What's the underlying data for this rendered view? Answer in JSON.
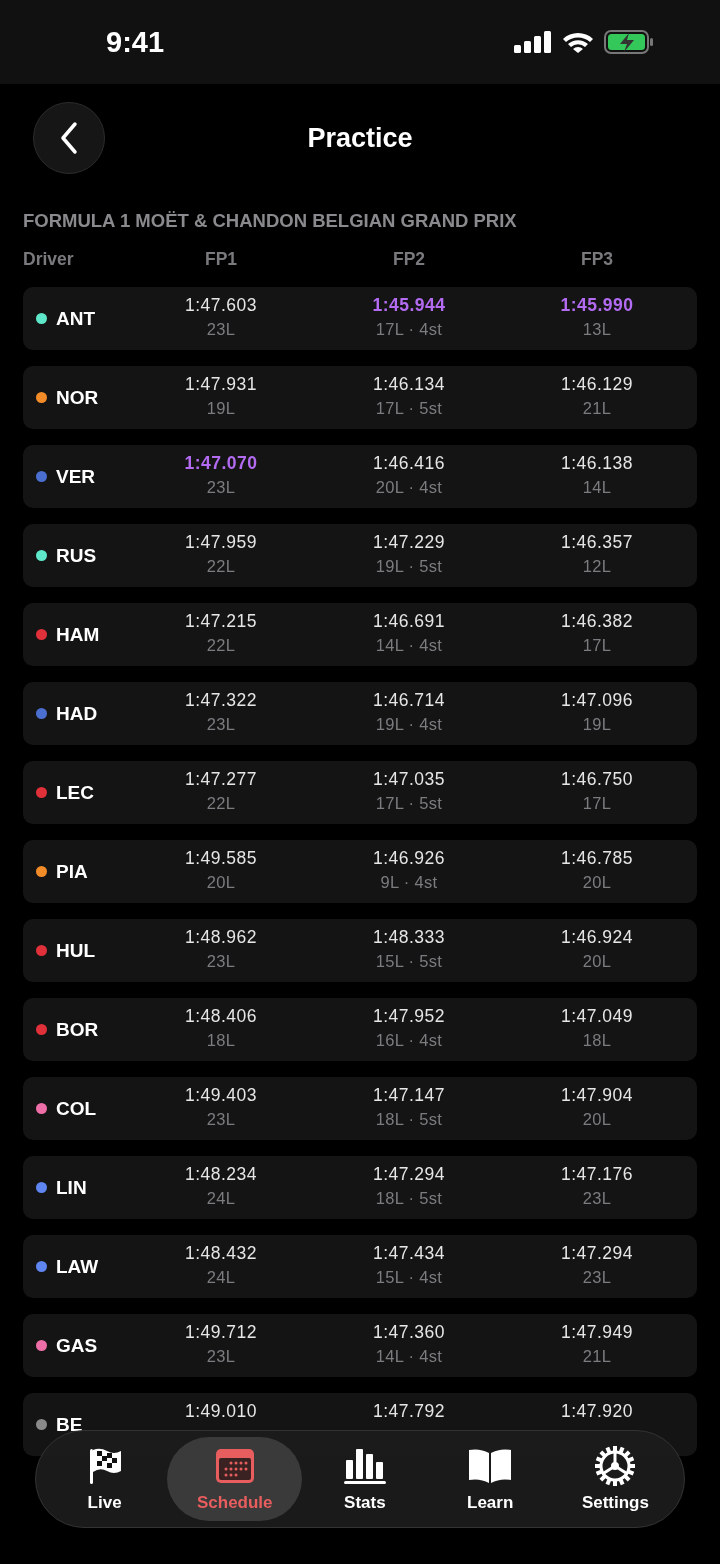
{
  "status_bar": {
    "time": "9:41"
  },
  "header": {
    "title": "Practice"
  },
  "event": {
    "title": "FORMULA 1 MOËT & CHANDON BELGIAN GRAND PRIX"
  },
  "columns": [
    "Driver",
    "FP1",
    "FP2",
    "FP3"
  ],
  "rows": [
    {
      "driver": "ANT",
      "color": "#5ee8c9",
      "sessions": [
        {
          "time": "1:47.603",
          "laps": "23L",
          "best": false
        },
        {
          "time": "1:45.944",
          "laps": "17L · 4st",
          "best": true
        },
        {
          "time": "1:45.990",
          "laps": "13L",
          "best": true
        }
      ]
    },
    {
      "driver": "NOR",
      "color": "#f28c28",
      "sessions": [
        {
          "time": "1:47.931",
          "laps": "19L",
          "best": false
        },
        {
          "time": "1:46.134",
          "laps": "17L · 5st",
          "best": false
        },
        {
          "time": "1:46.129",
          "laps": "21L",
          "best": false
        }
      ]
    },
    {
      "driver": "VER",
      "color": "#4a6fd1",
      "sessions": [
        {
          "time": "1:47.070",
          "laps": "23L",
          "best": true
        },
        {
          "time": "1:46.416",
          "laps": "20L · 4st",
          "best": false
        },
        {
          "time": "1:46.138",
          "laps": "14L",
          "best": false
        }
      ]
    },
    {
      "driver": "RUS",
      "color": "#5ee8c9",
      "sessions": [
        {
          "time": "1:47.959",
          "laps": "22L",
          "best": false
        },
        {
          "time": "1:47.229",
          "laps": "19L · 5st",
          "best": false
        },
        {
          "time": "1:46.357",
          "laps": "12L",
          "best": false
        }
      ]
    },
    {
      "driver": "HAM",
      "color": "#e0303a",
      "sessions": [
        {
          "time": "1:47.215",
          "laps": "22L",
          "best": false
        },
        {
          "time": "1:46.691",
          "laps": "14L · 4st",
          "best": false
        },
        {
          "time": "1:46.382",
          "laps": "17L",
          "best": false
        }
      ]
    },
    {
      "driver": "HAD",
      "color": "#4a6fd1",
      "sessions": [
        {
          "time": "1:47.322",
          "laps": "23L",
          "best": false
        },
        {
          "time": "1:46.714",
          "laps": "19L · 4st",
          "best": false
        },
        {
          "time": "1:47.096",
          "laps": "19L",
          "best": false
        }
      ]
    },
    {
      "driver": "LEC",
      "color": "#e0303a",
      "sessions": [
        {
          "time": "1:47.277",
          "laps": "22L",
          "best": false
        },
        {
          "time": "1:47.035",
          "laps": "17L · 5st",
          "best": false
        },
        {
          "time": "1:46.750",
          "laps": "17L",
          "best": false
        }
      ]
    },
    {
      "driver": "PIA",
      "color": "#f28c28",
      "sessions": [
        {
          "time": "1:49.585",
          "laps": "20L",
          "best": false
        },
        {
          "time": "1:46.926",
          "laps": "9L · 4st",
          "best": false
        },
        {
          "time": "1:46.785",
          "laps": "20L",
          "best": false
        }
      ]
    },
    {
      "driver": "HUL",
      "color": "#e0303a",
      "sessions": [
        {
          "time": "1:48.962",
          "laps": "23L",
          "best": false
        },
        {
          "time": "1:48.333",
          "laps": "15L · 5st",
          "best": false
        },
        {
          "time": "1:46.924",
          "laps": "20L",
          "best": false
        }
      ]
    },
    {
      "driver": "BOR",
      "color": "#e0303a",
      "sessions": [
        {
          "time": "1:48.406",
          "laps": "18L",
          "best": false
        },
        {
          "time": "1:47.952",
          "laps": "16L · 4st",
          "best": false
        },
        {
          "time": "1:47.049",
          "laps": "18L",
          "best": false
        }
      ]
    },
    {
      "driver": "COL",
      "color": "#ee6fa8",
      "sessions": [
        {
          "time": "1:49.403",
          "laps": "23L",
          "best": false
        },
        {
          "time": "1:47.147",
          "laps": "18L · 5st",
          "best": false
        },
        {
          "time": "1:47.904",
          "laps": "20L",
          "best": false
        }
      ]
    },
    {
      "driver": "LIN",
      "color": "#5f86f0",
      "sessions": [
        {
          "time": "1:48.234",
          "laps": "24L",
          "best": false
        },
        {
          "time": "1:47.294",
          "laps": "18L · 5st",
          "best": false
        },
        {
          "time": "1:47.176",
          "laps": "23L",
          "best": false
        }
      ]
    },
    {
      "driver": "LAW",
      "color": "#5f86f0",
      "sessions": [
        {
          "time": "1:48.432",
          "laps": "24L",
          "best": false
        },
        {
          "time": "1:47.434",
          "laps": "15L · 4st",
          "best": false
        },
        {
          "time": "1:47.294",
          "laps": "23L",
          "best": false
        }
      ]
    },
    {
      "driver": "GAS",
      "color": "#ee6fa8",
      "sessions": [
        {
          "time": "1:49.712",
          "laps": "23L",
          "best": false
        },
        {
          "time": "1:47.360",
          "laps": "14L · 4st",
          "best": false
        },
        {
          "time": "1:47.949",
          "laps": "21L",
          "best": false
        }
      ]
    },
    {
      "driver": "BE",
      "color": "#8a8a8a",
      "sessions": [
        {
          "time": "1:49.010",
          "best": false
        },
        {
          "time": "1:47.792",
          "best": false
        },
        {
          "time": "1:47.920",
          "best": false
        }
      ]
    }
  ],
  "tab_bar": [
    {
      "label": "Live",
      "selected": false
    },
    {
      "label": "Schedule",
      "selected": true
    },
    {
      "label": "Stats",
      "selected": false
    },
    {
      "label": "Learn",
      "selected": false
    },
    {
      "label": "Settings",
      "selected": false
    }
  ]
}
